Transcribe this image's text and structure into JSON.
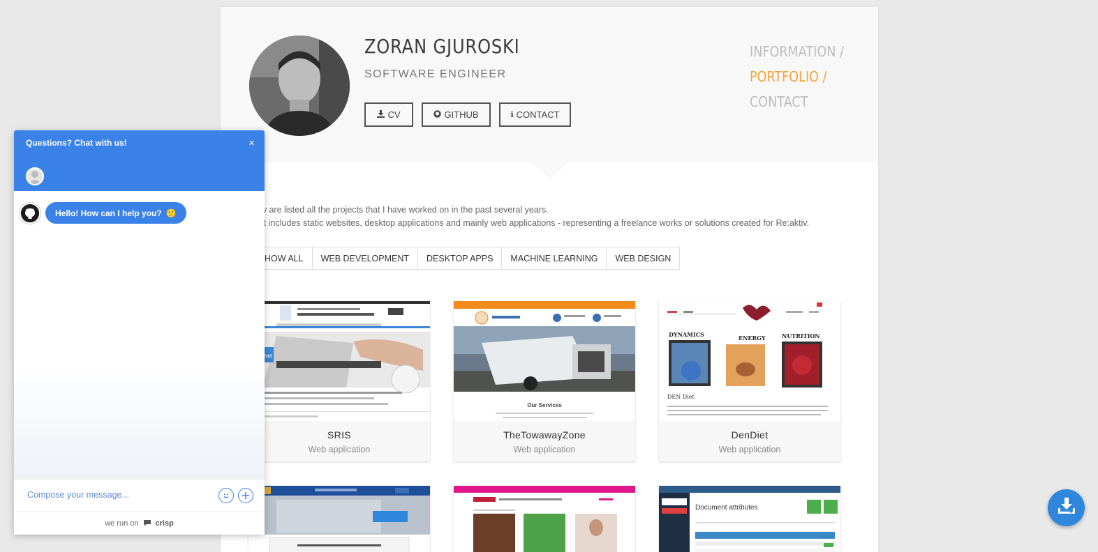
{
  "profile": {
    "name": "ZORAN GJUROSKI",
    "role": "SOFTWARE ENGINEER",
    "buttons": {
      "cv": "CV",
      "github": "GITHUB",
      "contact": "CONTACT"
    }
  },
  "nav": {
    "items": [
      "INFORMATION /",
      "PORTFOLIO /",
      "CONTACT"
    ],
    "active": "PORTFOLIO /"
  },
  "intro": {
    "line1": "ow are listed all the projects that I have worked on in the past several years.",
    "line2": "list includes static websites, desktop applications and mainly web applications - representing a freelance works or solutions created for Re:aktiv."
  },
  "filters": [
    "HOW ALL",
    "WEB DEVELOPMENT",
    "DESKTOP APPS",
    "MACHINE LEARNING",
    "WEB DESIGN"
  ],
  "projects": [
    {
      "title": "SRIS",
      "subtitle": "Web application"
    },
    {
      "title": "TheTowawayZone",
      "subtitle": "Web application"
    },
    {
      "title": "DenDiet",
      "subtitle": "Web application"
    }
  ],
  "project_thumb_text": {
    "towaway_services": "Our Services",
    "dendiet_dynamics": "DYNAMICS",
    "dendiet_energy": "ENERGY",
    "dendiet_nutrition": "NUTRITION",
    "dendiet_caption": "DEN Diet",
    "doc_attributes": "Document attributes",
    "sris_pocetna": "Почетна"
  },
  "chat": {
    "title": "Questions? Chat with us!",
    "close": "×",
    "greeting": "Hello! How can I help you?",
    "greeting_emoji": "🙂",
    "placeholder": "Compose your message...",
    "footer_prefix": "we run on",
    "footer_brand": "crisp"
  },
  "colors": {
    "accent": "#f0a53a",
    "chat_blue": "#3b82e8",
    "fab_blue": "#2f86dd"
  },
  "icons": [
    "download-icon",
    "github-icon",
    "info-icon",
    "close-icon",
    "emoji-icon",
    "plus-icon",
    "crisp-icon",
    "download-fab-icon"
  ]
}
